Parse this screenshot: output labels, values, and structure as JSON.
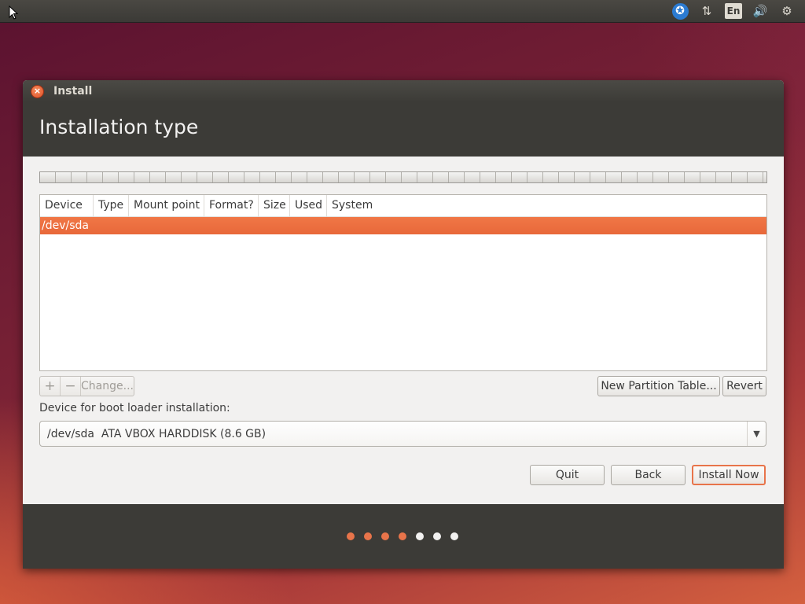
{
  "panel": {
    "tray": [
      {
        "icon": "accessibility-icon",
        "glyph": "✪"
      },
      {
        "icon": "network-icon",
        "glyph": "⇅"
      },
      {
        "icon": "keyboard-layout-icon",
        "glyph": "En"
      },
      {
        "icon": "volume-icon",
        "glyph": "🔊"
      },
      {
        "icon": "gear-icon",
        "glyph": "⚙"
      }
    ]
  },
  "window": {
    "title": "Install",
    "close_glyph": "×"
  },
  "page": {
    "title": "Installation type"
  },
  "partition_table": {
    "columns": [
      "Device",
      "Type",
      "Mount point",
      "Format?",
      "Size",
      "Used",
      "System"
    ],
    "rows": [
      {
        "device": "/dev/sda",
        "selected": true
      }
    ]
  },
  "toolbar": {
    "add_glyph": "+",
    "remove_glyph": "−",
    "change_label": "Change...",
    "new_partition_table_label": "New Partition Table...",
    "revert_label": "Revert"
  },
  "bootloader": {
    "label": "Device for boot loader installation:",
    "selected": "/dev/sda  ATA VBOX HARDDISK (8.6 GB)",
    "arrow_glyph": "▼"
  },
  "actions": {
    "quit_label": "Quit",
    "back_label": "Back",
    "install_label": "Install Now"
  },
  "progress": {
    "total_steps": 7,
    "completed_steps": 4,
    "active_color": "#e8744a",
    "inactive_color": "#f2f1f0"
  },
  "colors": {
    "accent": "#e8744a",
    "selection": "#f07746",
    "header": "#3c3b37"
  }
}
